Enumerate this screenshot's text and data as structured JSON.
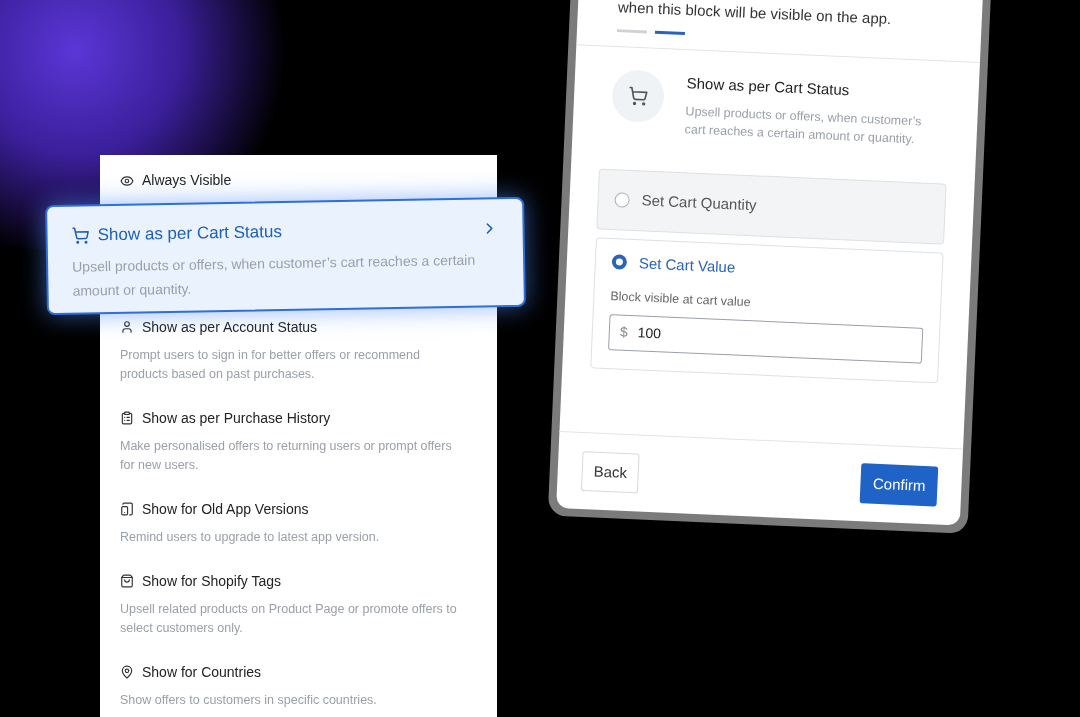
{
  "conditions_list": {
    "options": [
      {
        "title": "Always Visible",
        "selected": false
      },
      {
        "title": "Show as per Cart Status",
        "description": "Upsell products or offers, when customer’s cart reaches a certain amount or quantity.",
        "selected": true
      },
      {
        "title": "Show as per Account Status",
        "description": "Prompt users to sign in for better offers or recommend products based on past purchases.",
        "selected": false
      },
      {
        "title": "Show as per Purchase History",
        "description": "Make personalised offers to returning users or prompt offers for new users.",
        "selected": false
      },
      {
        "title": "Show for Old App Versions",
        "description": "Remind users to upgrade to latest app version.",
        "selected": false
      },
      {
        "title": "Show for Shopify Tags",
        "description": "Upsell related products on Product Page or promote offers to select customers only.",
        "selected": false
      },
      {
        "title": "Show for Countries",
        "description": "Show offers to customers in specific countries.",
        "selected": false
      }
    ]
  },
  "dialog": {
    "hint": "when this block will be visible on the app.",
    "steps": [
      {
        "selected": false
      },
      {
        "selected": true
      }
    ],
    "condition": {
      "title": "Show as per Cart Status",
      "description": "Upsell products or offers, when customer’s cart reaches a certain amount or quantity."
    },
    "cart_options": [
      {
        "label": "Set Cart Quantity",
        "selected": false
      },
      {
        "label": "Set Cart Value",
        "selected": true,
        "field": {
          "label": "Block visible at cart value",
          "prefix": "$",
          "value": "100"
        }
      }
    ],
    "buttons": {
      "back": "Back",
      "confirm": "Confirm"
    }
  }
}
